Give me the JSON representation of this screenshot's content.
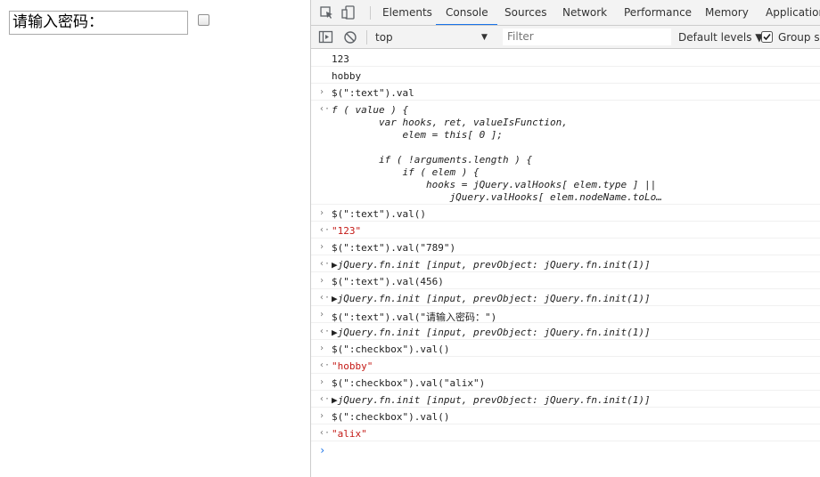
{
  "page": {
    "input_value": "请输入密码：",
    "checkbox_checked": false
  },
  "devtools": {
    "tabs": [
      "Elements",
      "Console",
      "Sources",
      "Network",
      "Performance",
      "Memory",
      "Application"
    ],
    "active_tab": "Console",
    "context": "top",
    "filter_placeholder": "Filter",
    "levels_label": "Default levels ▼",
    "group_label": "Group sir",
    "group_checked": true
  },
  "console": {
    "lines": [
      {
        "kind": "log",
        "text": "123"
      },
      {
        "kind": "log",
        "text": "hobby"
      },
      {
        "kind": "in",
        "text": "$(\":text\").val"
      },
      {
        "kind": "out",
        "text": "f ( value ) {"
      },
      {
        "kind": "cont",
        "text": "        var hooks, ret, valueIsFunction,"
      },
      {
        "kind": "cont",
        "text": "            elem = this[ 0 ];"
      },
      {
        "kind": "cont",
        "text": ""
      },
      {
        "kind": "cont",
        "text": "        if ( !arguments.length ) {"
      },
      {
        "kind": "cont",
        "text": "            if ( elem ) {"
      },
      {
        "kind": "cont",
        "text": "                hooks = jQuery.valHooks[ elem.type ] ||"
      },
      {
        "kind": "cont",
        "text": "                    jQuery.valHooks[ elem.nodeName.toLo…"
      },
      {
        "kind": "in",
        "text": "$(\":text\").val()"
      },
      {
        "kind": "out",
        "text": "\"123\""
      },
      {
        "kind": "in",
        "text": "$(\":text\").val(\"789\")"
      },
      {
        "kind": "out",
        "text": "▶jQuery.fn.init [input, prevObject: jQuery.fn.init(1)]"
      },
      {
        "kind": "in",
        "text": "$(\":text\").val(456)"
      },
      {
        "kind": "out",
        "text": "▶jQuery.fn.init [input, prevObject: jQuery.fn.init(1)]"
      },
      {
        "kind": "in",
        "text": "$(\":text\").val(\"请输入密码：\")"
      },
      {
        "kind": "out",
        "text": "▶jQuery.fn.init [input, prevObject: jQuery.fn.init(1)]"
      },
      {
        "kind": "in",
        "text": "$(\":checkbox\").val()"
      },
      {
        "kind": "out",
        "text": "\"hobby\""
      },
      {
        "kind": "in",
        "text": "$(\":checkbox\").val(\"alix\")"
      },
      {
        "kind": "out",
        "text": "▶jQuery.fn.init [input, prevObject: jQuery.fn.init(1)]"
      },
      {
        "kind": "in",
        "text": "$(\":checkbox\").val()"
      },
      {
        "kind": "out",
        "text": "\"alix\""
      }
    ],
    "prompt_glyph": "›",
    "input_glyph": "›",
    "output_glyph": "‹·"
  }
}
